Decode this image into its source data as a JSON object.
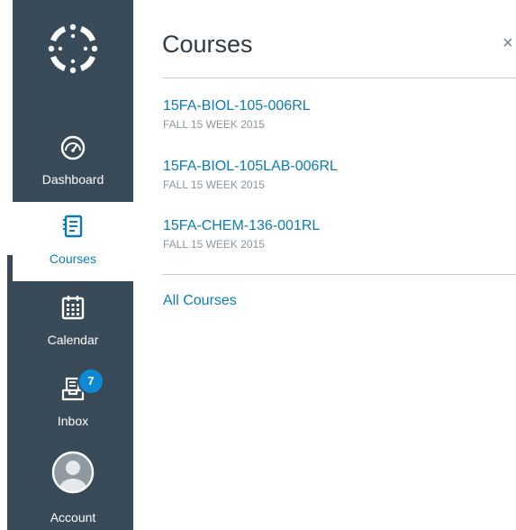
{
  "nav": {
    "items": [
      {
        "id": "dashboard",
        "label": "Dashboard"
      },
      {
        "id": "courses",
        "label": "Courses"
      },
      {
        "id": "calendar",
        "label": "Calendar"
      },
      {
        "id": "inbox",
        "label": "Inbox",
        "badge": "7"
      },
      {
        "id": "account",
        "label": "Account"
      }
    ],
    "active": "courses"
  },
  "tray": {
    "title": "Courses",
    "close_label": "×",
    "courses": [
      {
        "name": "15FA-BIOL-105-006RL",
        "term": "FALL 15 WEEK 2015"
      },
      {
        "name": "15FA-BIOL-105LAB-006RL",
        "term": "FALL 15 WEEK 2015"
      },
      {
        "name": "15FA-CHEM-136-001RL",
        "term": "FALL 15 WEEK 2015"
      }
    ],
    "all_courses_label": "All Courses"
  },
  "colors": {
    "nav_bg": "#394b58",
    "link": "#0b7bb8",
    "badge": "#0b89d2"
  }
}
